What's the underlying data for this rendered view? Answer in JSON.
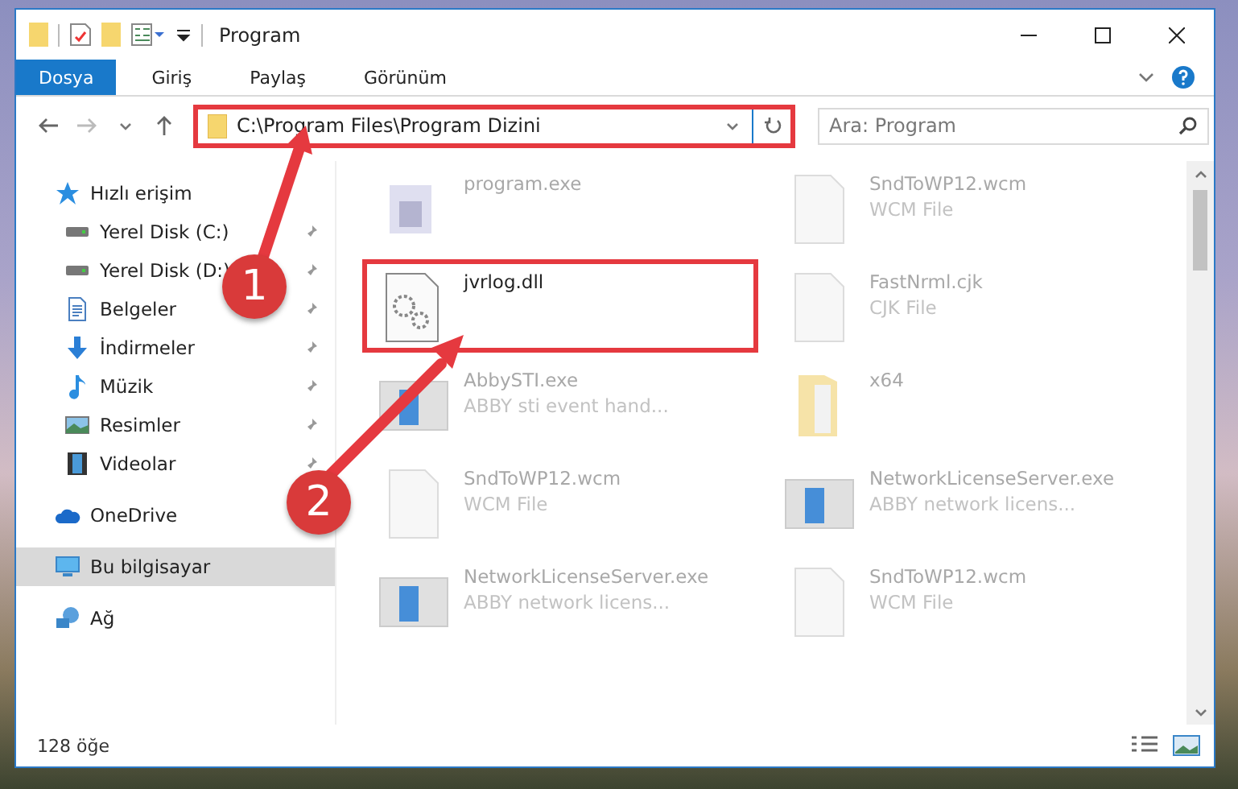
{
  "window": {
    "title": "Program"
  },
  "ribbon_tabs": [
    {
      "label": "Dosya",
      "selected": true
    },
    {
      "label": "Giriş",
      "selected": false
    },
    {
      "label": "Paylaş",
      "selected": false
    },
    {
      "label": "Görünüm",
      "selected": false
    }
  ],
  "address": {
    "path": "C:\\Program Files\\Program Dizini",
    "highlighted": true
  },
  "search": {
    "placeholder": "Ara: Program"
  },
  "sidebar": {
    "items": [
      {
        "label": "Hızlı erişim",
        "kind": "quick",
        "selected": false,
        "children": [
          {
            "label": "Yerel Disk (C:)",
            "kind": "drive",
            "pinned": true,
            "selected": false
          },
          {
            "label": "Yerel Disk (D:)",
            "kind": "drive",
            "pinned": true,
            "selected": false
          },
          {
            "label": "Belgeler",
            "kind": "documents",
            "pinned": true,
            "selected": false
          },
          {
            "label": "İndirmeler",
            "kind": "downloads",
            "pinned": true,
            "selected": false
          },
          {
            "label": "Müzik",
            "kind": "music",
            "pinned": true,
            "selected": false
          },
          {
            "label": "Resimler",
            "kind": "pictures",
            "pinned": true,
            "selected": false
          },
          {
            "label": "Videolar",
            "kind": "videos",
            "pinned": true,
            "selected": false
          }
        ]
      },
      {
        "label": "OneDrive",
        "kind": "cloud",
        "selected": false
      },
      {
        "label": "Bu bilgisayar",
        "kind": "pc",
        "selected": true
      },
      {
        "label": "Ağ",
        "kind": "network",
        "selected": false
      }
    ]
  },
  "files": [
    {
      "name": "program.exe",
      "kind": "app",
      "dimmed": true,
      "highlighted": false
    },
    {
      "name": "SndToWP12.wcm",
      "type": "WCM File",
      "kind": "doc",
      "dimmed": true,
      "highlighted": false
    },
    {
      "name": "jvrlog.dll",
      "kind": "dll",
      "dimmed": false,
      "highlighted": true
    },
    {
      "name": "FastNrml.cjk",
      "type": "CJK File",
      "kind": "doc",
      "dimmed": true,
      "highlighted": false
    },
    {
      "name": "AbbySTI.exe",
      "type": "ABBY sti event hand...",
      "kind": "window",
      "dimmed": true,
      "highlighted": false
    },
    {
      "name": "x64",
      "kind": "folder",
      "dimmed": true,
      "highlighted": false
    },
    {
      "name": "SndToWP12.wcm",
      "type": "WCM File",
      "kind": "doc",
      "dimmed": true,
      "highlighted": false
    },
    {
      "name": "NetworkLicenseServer.exe",
      "type": "ABBY network licens...",
      "kind": "window",
      "dimmed": true,
      "highlighted": false
    },
    {
      "name": "NetworkLicenseServer.exe",
      "type": "ABBY network licens...",
      "kind": "window",
      "dimmed": true,
      "highlighted": false
    },
    {
      "name": "SndToWP12.wcm",
      "type": "WCM File",
      "kind": "doc",
      "dimmed": true,
      "highlighted": false
    }
  ],
  "annotations": [
    {
      "number": "1"
    },
    {
      "number": "2"
    }
  ],
  "status_bar": {
    "count": "128 öğe"
  }
}
